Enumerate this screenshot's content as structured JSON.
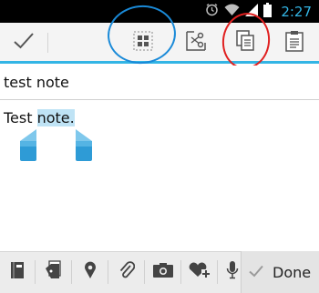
{
  "status_bar": {
    "time": "2:27",
    "icons": [
      "alarm-icon",
      "wifi-icon",
      "signal-icon",
      "battery-icon"
    ]
  },
  "action_bar": {
    "buttons": [
      "done-check-icon",
      "select-all-icon",
      "cut-icon",
      "copy-icon",
      "paste-icon"
    ]
  },
  "note": {
    "title": "test note",
    "body_before": "Test ",
    "body_selected": "note.",
    "selection_color": "#bfe3f5",
    "handle_color": "#2e9bd6"
  },
  "bottom_bar": {
    "buttons": [
      "notebook-icon",
      "tag-icon",
      "location-icon",
      "attachment-icon",
      "camera-icon",
      "add-icon-image",
      "microphone-icon"
    ],
    "done_label": "Done"
  },
  "colors": {
    "accent": "#33b5e5",
    "annotation_blue": "#1a8ad8",
    "annotation_red": "#e02020"
  }
}
